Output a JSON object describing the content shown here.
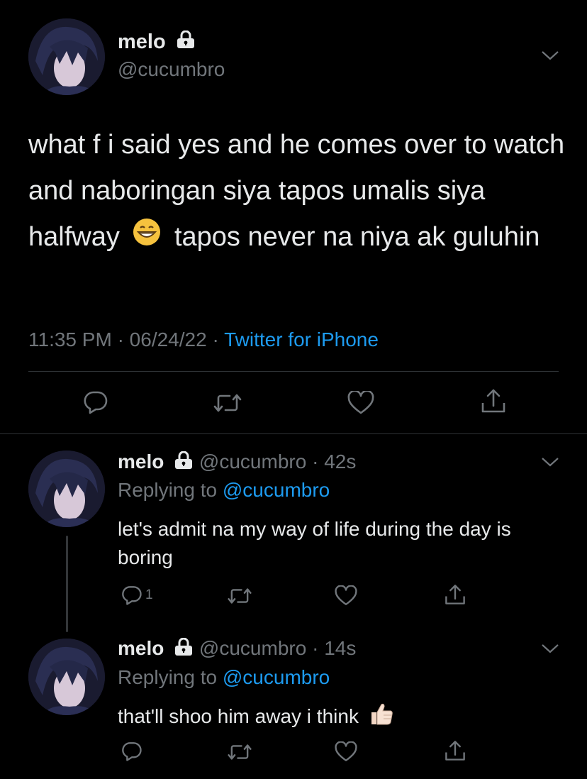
{
  "main_tweet": {
    "display_name": "melo",
    "handle": "@cucumbro",
    "text_before_emoji": "what f i said yes and he comes over to watch and naboringan siya tapos umalis siya halfway",
    "text_after_emoji": "tapos never na niya ak guluhin",
    "time": "11:35 PM",
    "date": "06/24/22",
    "source": "Twitter for iPhone"
  },
  "replies": [
    {
      "display_name": "melo",
      "handle": "@cucumbro",
      "age": "42s",
      "replying_label": "Replying to",
      "replying_handle": "@cucumbro",
      "text": "let's admit na my way of life during the day is boring",
      "reply_count": "1"
    },
    {
      "display_name": "melo",
      "handle": "@cucumbro",
      "age": "14s",
      "replying_label": "Replying to",
      "replying_handle": "@cucumbro",
      "text": "that'll shoo him away i think",
      "reply_count": ""
    }
  ],
  "icons": [
    "lock-icon",
    "chevron-down-icon",
    "reply-icon",
    "retweet-icon",
    "like-icon",
    "share-icon",
    "grin-emoji",
    "thumbs-up-emoji"
  ],
  "colors": {
    "background": "#000000",
    "link": "#1d9bf0",
    "muted": "#71767b",
    "text": "#e7e9ea",
    "divider": "#2f3336"
  }
}
